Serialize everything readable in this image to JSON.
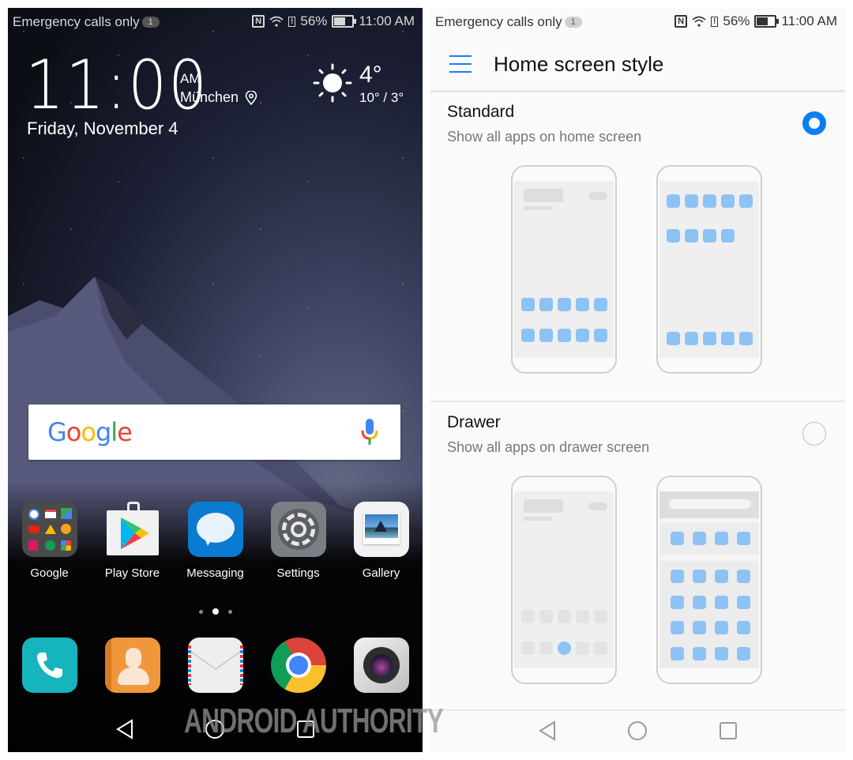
{
  "left_screen": {
    "status_bar": {
      "carrier": "Emergency calls only",
      "notification_count": "1",
      "battery": "56%",
      "time": "11:00 AM"
    },
    "clock_widget": {
      "time": "11:00",
      "ampm": "AM",
      "city": "München",
      "date": "Friday, November 4"
    },
    "weather_widget": {
      "temperature": "4°",
      "range": "10° / 3°",
      "icon": "sun-icon"
    },
    "search_bar": {
      "logo": [
        "G",
        "o",
        "o",
        "g",
        "l",
        "e"
      ],
      "logo_colors": [
        "#4285f4",
        "#ea4335",
        "#fbbc05",
        "#4285f4",
        "#34a853",
        "#ea4335"
      ]
    },
    "apps": [
      {
        "label": "Google",
        "icon": "google-folder-icon"
      },
      {
        "label": "Play Store",
        "icon": "play-store-icon"
      },
      {
        "label": "Messaging",
        "icon": "messaging-icon"
      },
      {
        "label": "Settings",
        "icon": "settings-icon"
      },
      {
        "label": "Gallery",
        "icon": "gallery-icon"
      }
    ],
    "page_indicator": {
      "pages": 3,
      "active": 2
    },
    "dock": [
      {
        "name": "phone",
        "icon": "phone-icon"
      },
      {
        "name": "contacts",
        "icon": "contacts-icon"
      },
      {
        "name": "email",
        "icon": "email-icon"
      },
      {
        "name": "chrome",
        "icon": "chrome-icon"
      },
      {
        "name": "camera",
        "icon": "camera-icon"
      }
    ]
  },
  "right_screen": {
    "status_bar": {
      "carrier": "Emergency calls only",
      "notification_count": "1",
      "battery": "56%",
      "time": "11:00 AM"
    },
    "title": "Home screen style",
    "options": [
      {
        "title": "Standard",
        "subtitle": "Show all apps on home screen",
        "selected": true
      },
      {
        "title": "Drawer",
        "subtitle": "Show all apps on drawer screen",
        "selected": false
      }
    ],
    "accent_color": "#0a7ff0",
    "watermark": "ANDROID AUTHORITY"
  }
}
